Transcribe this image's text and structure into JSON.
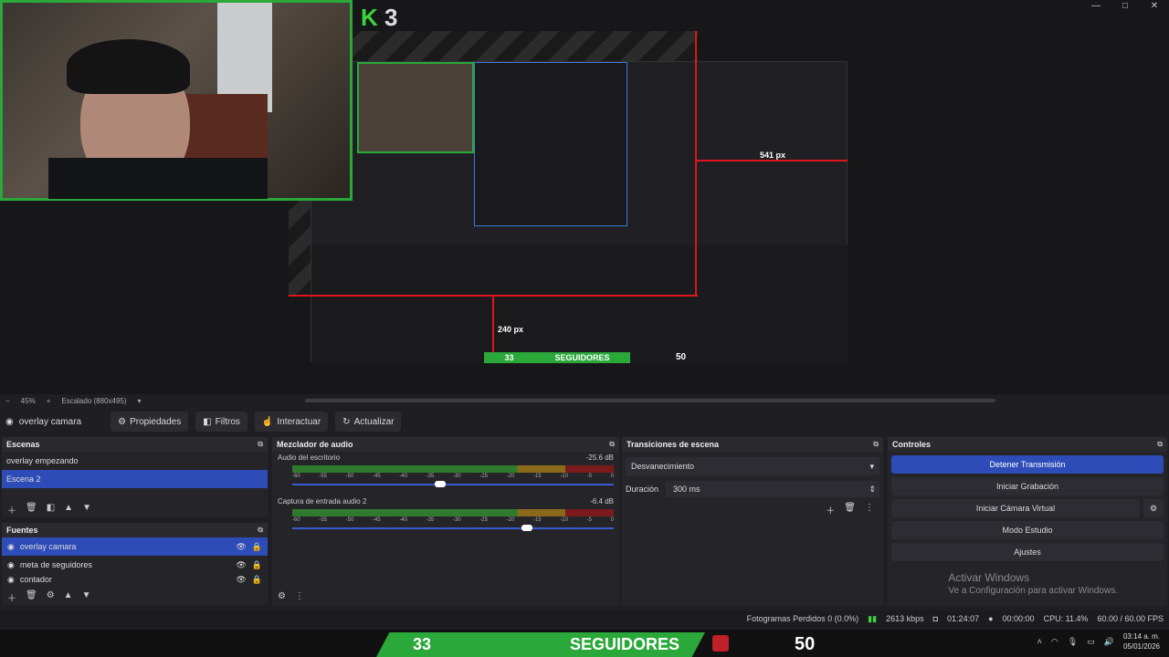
{
  "window": {
    "btn_min": "—",
    "btn_max": "□",
    "btn_close": "✕"
  },
  "preview": {
    "logo_k": "K",
    "logo_num": "3",
    "label_541": "541 px",
    "label_240": "240 px",
    "nested_left": "33",
    "nested_mid": "SEGUIDORES",
    "nested_right": "50"
  },
  "zoom": {
    "minus": "−",
    "level": "45%",
    "plus": "+",
    "scale": "Escalado (880x495)"
  },
  "source_toolbar": {
    "source_name": "overlay camara",
    "properties": "Propiedades",
    "filters": "Filtros",
    "interact": "Interactuar",
    "refresh": "Actualizar"
  },
  "escenas": {
    "title": "Escenas",
    "items": [
      {
        "label": "overlay empezando"
      },
      {
        "label": "Escena 2"
      }
    ]
  },
  "fuentes": {
    "title": "Fuentes",
    "items": [
      {
        "label": "overlay camara"
      },
      {
        "label": "meta de seguidores"
      },
      {
        "label": "contador"
      }
    ]
  },
  "mezclador": {
    "title": "Mezclador de audio",
    "channels": [
      {
        "name": "Audio del escritorio",
        "db": "-25.6 dB",
        "level": 0.46
      },
      {
        "name": "Captura de entrada audio 2",
        "db": "-6.4 dB",
        "level": 0.73
      }
    ],
    "ticks": [
      "-60",
      "-55",
      "-50",
      "-45",
      "-40",
      "-35",
      "-30",
      "-25",
      "-20",
      "-15",
      "-10",
      "-5",
      "0"
    ]
  },
  "transiciones": {
    "title": "Transiciones de escena",
    "selected": "Desvanecimiento",
    "duration_label": "Duración",
    "duration_value": "300 ms"
  },
  "controles": {
    "title": "Controles",
    "stop_stream": "Detener Transmisión",
    "start_rec": "Iniciar Grabación",
    "virtual_cam": "Iniciar Cámara Virtual",
    "studio": "Modo Estudio",
    "settings": "Ajustes"
  },
  "watermark": {
    "line1": "Activar Windows",
    "line2": "Ve a Configuración para activar Windows."
  },
  "status": {
    "dropped": "Fotogramas Perdidos 0 (0.0%)",
    "bitrate": "2613 kbps",
    "live_time": "01:24:07",
    "rec_time": "00:00:00",
    "cpu": "CPU: 11.4%",
    "fps": "60.00 / 60.00 FPS"
  },
  "overlay_bar": {
    "count": "33",
    "label": "SEGUIDORES",
    "goal": "50"
  },
  "clock": {
    "time": "03:14 a. m.",
    "date": "05/01/2026"
  },
  "colors": {
    "accent": "#2e4cb8",
    "green": "#2aa83a",
    "red": "#e0141e"
  }
}
